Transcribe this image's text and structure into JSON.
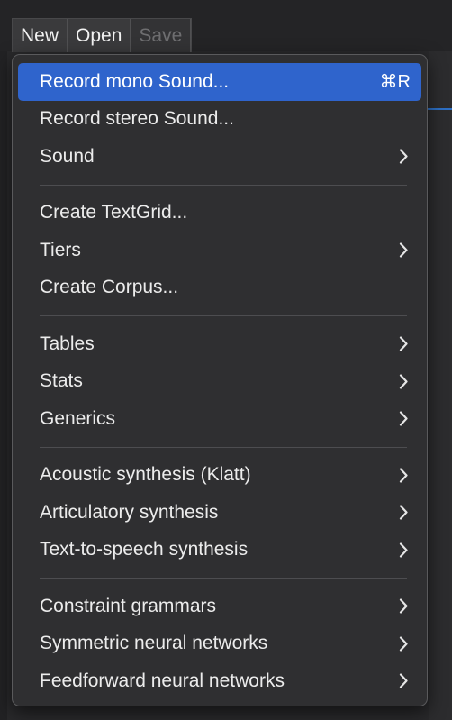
{
  "menubar": {
    "items": [
      {
        "label": "New",
        "state": "active"
      },
      {
        "label": "Open",
        "state": "normal"
      },
      {
        "label": "Save",
        "state": "disabled"
      }
    ]
  },
  "menu": {
    "groups": [
      [
        {
          "label": "Record mono Sound...",
          "shortcut": "⌘R",
          "submenu": false,
          "highlighted": true
        },
        {
          "label": "Record stereo Sound...",
          "shortcut": "",
          "submenu": false
        },
        {
          "label": "Sound",
          "shortcut": "",
          "submenu": true
        }
      ],
      [
        {
          "label": "Create TextGrid...",
          "shortcut": "",
          "submenu": false
        },
        {
          "label": "Tiers",
          "shortcut": "",
          "submenu": true
        },
        {
          "label": "Create Corpus...",
          "shortcut": "",
          "submenu": false
        }
      ],
      [
        {
          "label": "Tables",
          "shortcut": "",
          "submenu": true
        },
        {
          "label": "Stats",
          "shortcut": "",
          "submenu": true
        },
        {
          "label": "Generics",
          "shortcut": "",
          "submenu": true
        }
      ],
      [
        {
          "label": "Acoustic synthesis (Klatt)",
          "shortcut": "",
          "submenu": true
        },
        {
          "label": "Articulatory synthesis",
          "shortcut": "",
          "submenu": true
        },
        {
          "label": "Text-to-speech synthesis",
          "shortcut": "",
          "submenu": true
        }
      ],
      [
        {
          "label": "Constraint grammars",
          "shortcut": "",
          "submenu": true
        },
        {
          "label": "Symmetric neural networks",
          "shortcut": "",
          "submenu": true
        },
        {
          "label": "Feedforward neural networks",
          "shortcut": "",
          "submenu": true
        }
      ]
    ]
  },
  "colors": {
    "highlight": "#2f64cc",
    "menu_bg": "#2f2f31",
    "text": "#ececec",
    "disabled_text": "#6e6e70"
  }
}
